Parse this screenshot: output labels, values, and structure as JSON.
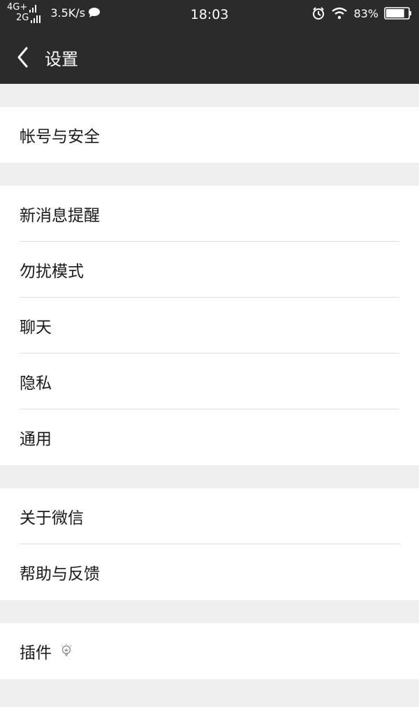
{
  "status_bar": {
    "network_primary": "4G+",
    "network_secondary": "2G",
    "speed": "3.5K/s",
    "time": "18:03",
    "battery_percent": "83%",
    "battery_level": 0.83,
    "icons": [
      "signal-bars-icon",
      "chat-bubble-icon",
      "alarm-clock-icon",
      "wifi-icon",
      "battery-icon"
    ]
  },
  "header": {
    "title": "设置",
    "back_icon": "chevron-left-icon"
  },
  "settings_groups": [
    {
      "items": [
        {
          "label": "帐号与安全"
        }
      ]
    },
    {
      "items": [
        {
          "label": "新消息提醒"
        },
        {
          "label": "勿扰模式"
        },
        {
          "label": "聊天"
        },
        {
          "label": "隐私"
        },
        {
          "label": "通用"
        }
      ]
    },
    {
      "items": [
        {
          "label": "关于微信"
        },
        {
          "label": "帮助与反馈"
        }
      ]
    },
    {
      "items": [
        {
          "label": "插件",
          "icon": "lightbulb-icon"
        }
      ]
    }
  ],
  "colors": {
    "header_bg": "#2b2b2b",
    "page_bg": "#efefef",
    "row_bg": "#ffffff",
    "divider": "#dddddd"
  }
}
